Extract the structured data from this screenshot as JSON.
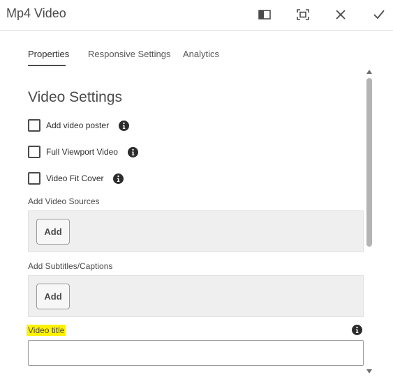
{
  "dialog": {
    "title": "Mp4 Video",
    "header_buttons": [
      "toggle-side-panel-icon",
      "fullscreen-icon",
      "close-icon",
      "checkmark-icon"
    ]
  },
  "tabs": [
    {
      "label": "Properties",
      "active": true
    },
    {
      "label": "Responsive Settings",
      "active": false
    },
    {
      "label": "Analytics",
      "active": false
    }
  ],
  "video_settings": {
    "heading": "Video Settings",
    "checkboxes": [
      {
        "label": "Add video poster",
        "checked": false,
        "icon": "info-icon"
      },
      {
        "label": "Full Viewport Video",
        "checked": false,
        "icon": "info-icon"
      },
      {
        "label": "Video Fit Cover",
        "checked": false,
        "icon": "info-icon"
      }
    ],
    "video_sources": {
      "label": "Add Video Sources",
      "button": "Add"
    },
    "subtitles": {
      "label": "Add Subtitles/Captions",
      "button": "Add"
    },
    "video_title": {
      "label": "Video title",
      "value": "",
      "placeholder": "",
      "highlight_color": "#fff200",
      "icon": "info-icon"
    }
  },
  "colors": {
    "text": "#2c2c2c",
    "accent_highlight": "#fff200",
    "panel_bg": "#efefef"
  }
}
